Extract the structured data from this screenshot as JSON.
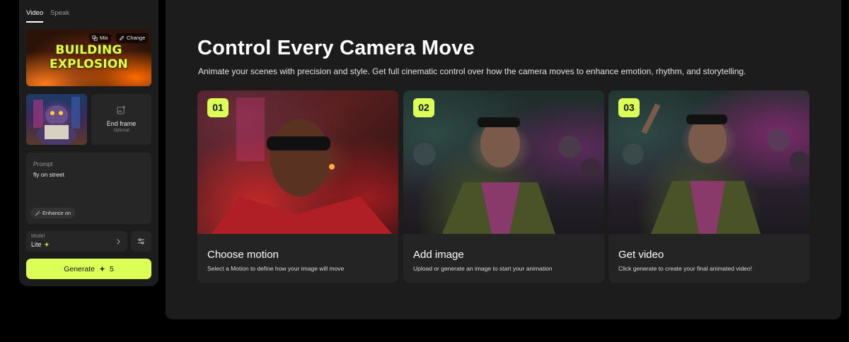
{
  "sidebar": {
    "tabs": [
      {
        "label": "Video",
        "active": true
      },
      {
        "label": "Speak",
        "active": false
      }
    ],
    "mix_card": {
      "title_lines": [
        "BUILDING",
        "EXPLOSION"
      ],
      "mix_label": "Mix",
      "change_label": "Change"
    },
    "end_frame": {
      "label": "End frame",
      "sublabel": "Optional"
    },
    "prompt": {
      "label": "Prompt",
      "value": "fly on street",
      "enhance_label": "Enhance on"
    },
    "model": {
      "label": "Model",
      "value": "Lite"
    },
    "generate": {
      "label": "Generate",
      "credits": "5"
    }
  },
  "main": {
    "title": "Control Every Camera Move",
    "subtitle": "Animate your scenes with precision and style. Get full cinematic control over how the camera moves to enhance emotion, rhythm, and storytelling.",
    "steps": [
      {
        "number": "01",
        "title": "Choose motion",
        "description": "Select a Motion to define how your image will move"
      },
      {
        "number": "02",
        "title": "Add image",
        "description": "Upload or generate an image to start your animation"
      },
      {
        "number": "03",
        "title": "Get video",
        "description": "Click generate to create your final animated video!"
      }
    ]
  },
  "colors": {
    "accent": "#dcff57",
    "panel": "#1c1c1c",
    "card": "#262626",
    "background": "#000000"
  },
  "icons": [
    "mix-icon",
    "pencil-icon",
    "image-plus-icon",
    "wand-icon",
    "sparkle-icon",
    "chevron-right-icon",
    "sliders-icon"
  ]
}
